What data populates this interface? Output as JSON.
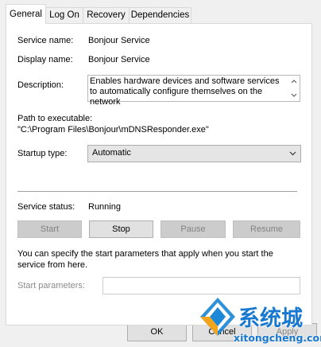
{
  "tabs": [
    {
      "label": "General",
      "active": true
    },
    {
      "label": "Log On",
      "active": false
    },
    {
      "label": "Recovery",
      "active": false
    },
    {
      "label": "Dependencies",
      "active": false
    }
  ],
  "fields": {
    "service_name_label": "Service name:",
    "service_name_value": "Bonjour Service",
    "display_name_label": "Display name:",
    "display_name_value": "Bonjour Service",
    "description_label": "Description:",
    "description_value": "Enables hardware devices and software services to automatically configure themselves on the network",
    "path_label": "Path to executable:",
    "path_value": "\"C:\\Program Files\\Bonjour\\mDNSResponder.exe\"",
    "startup_type_label": "Startup type:",
    "startup_type_value": "Automatic",
    "service_status_label": "Service status:",
    "service_status_value": "Running"
  },
  "control_buttons": {
    "start": "Start",
    "stop": "Stop",
    "pause": "Pause",
    "resume": "Resume"
  },
  "start_params": {
    "hint": "You can specify the start parameters that apply when you start the service from here.",
    "label": "Start parameters:",
    "value": ""
  },
  "dialog_buttons": {
    "ok": "OK",
    "cancel": "Cancel",
    "apply": "Apply"
  },
  "watermark": {
    "brand": "系统城",
    "site": "xitongcheng.com"
  }
}
